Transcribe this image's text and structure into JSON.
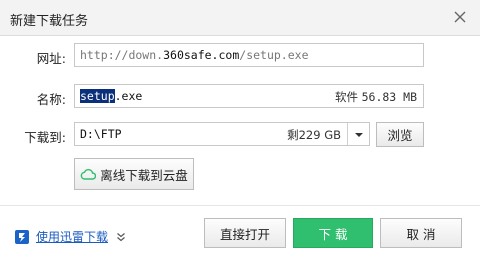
{
  "dialog": {
    "title": "新建下载任务"
  },
  "form": {
    "url_label": "网址:",
    "url_prefix": "http://down.",
    "url_host": "360safe.com",
    "url_suffix": "/setup.exe",
    "name_label": "名称:",
    "name_selected": "setup",
    "name_ext": ".exe",
    "size_prefix": "软件",
    "size_value": "56.83 MB",
    "saveto_label": "下载到:",
    "path": "D:\\FTP",
    "free_space": "剩229 GB",
    "browse_label": "浏览",
    "cloud_label": "离线下载到云盘"
  },
  "footer": {
    "thunder_link": "使用迅雷下载",
    "open_label": "直接打开",
    "download_label": "下 载",
    "cancel_label": "取 消"
  },
  "colors": {
    "primary": "#2fbf6f",
    "link": "#1a5bbf",
    "selection": "#0b2f7a"
  },
  "icons": [
    "close-icon",
    "chevron-down-icon",
    "cloud-icon",
    "thunder-icon",
    "double-chevron-down-icon"
  ]
}
